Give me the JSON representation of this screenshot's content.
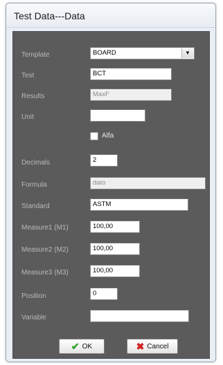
{
  "window": {
    "title": "Test Data---Data"
  },
  "form": {
    "template": {
      "label": "Template",
      "value": "BOARD"
    },
    "test": {
      "label": "Test",
      "value": "BCT"
    },
    "results": {
      "label": "Results",
      "value": "MaxF"
    },
    "unit": {
      "label": "Unit",
      "value": ""
    },
    "alfa": {
      "label": "Alfa",
      "checked": false
    },
    "decimals": {
      "label": "Decimals",
      "value": "2"
    },
    "formula": {
      "label": "Formula",
      "value": "dato"
    },
    "standard": {
      "label": "Standard",
      "value": "ASTM"
    },
    "measure1": {
      "label": "Measure1 (M1)",
      "value": "100,00"
    },
    "measure2": {
      "label": "Measure2 (M2)",
      "value": "100,00"
    },
    "measure3": {
      "label": "Measure3 (M3)",
      "value": "100,00"
    },
    "position": {
      "label": "Position",
      "value": "0"
    },
    "variable": {
      "label": "Variable",
      "value": ""
    }
  },
  "buttons": {
    "ok": "OK",
    "cancel": "Cancel"
  }
}
